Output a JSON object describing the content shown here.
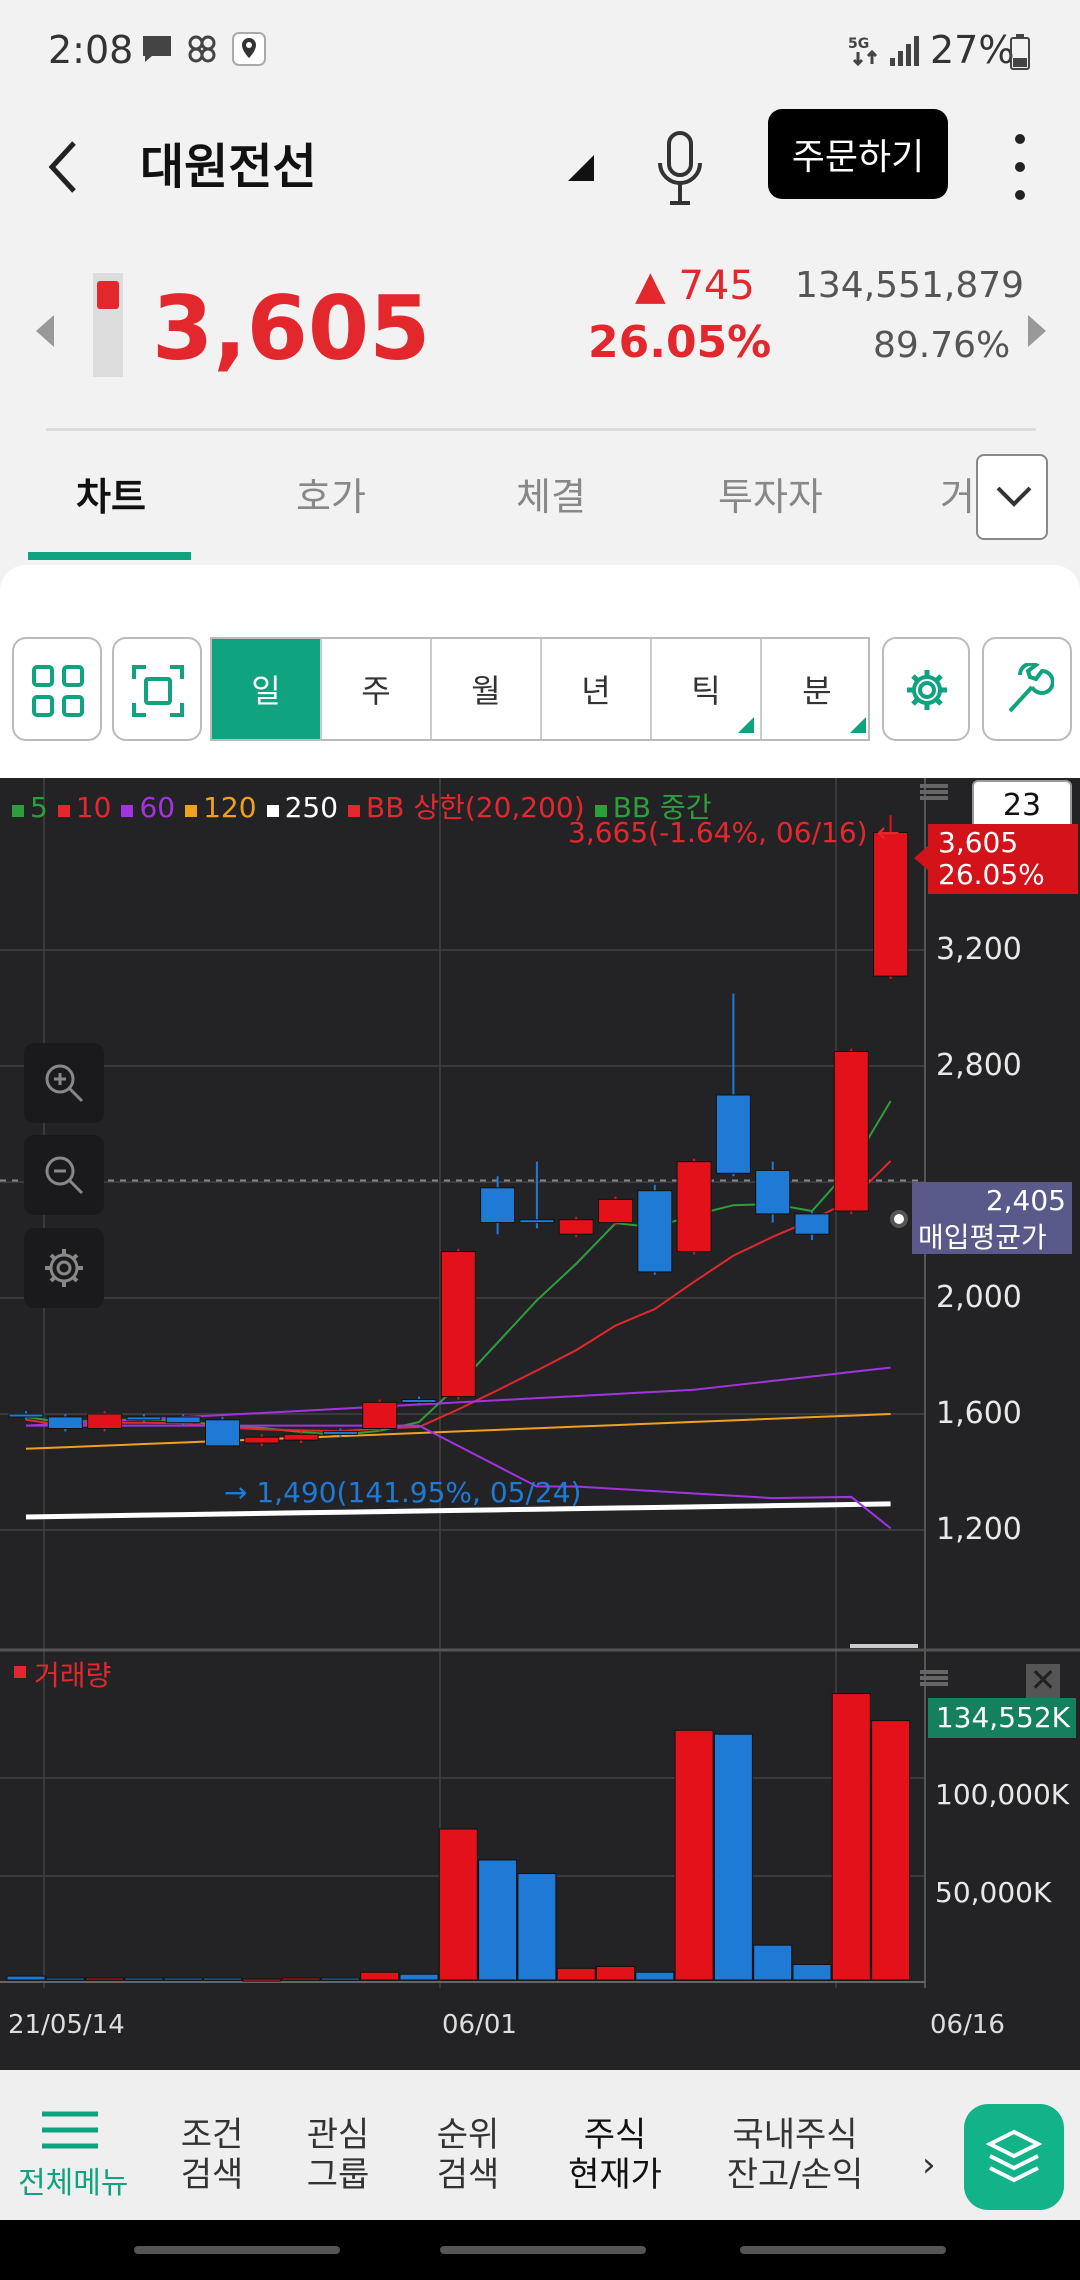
{
  "status_bar": {
    "time": "2:08",
    "right": "27%"
  },
  "header": {
    "title": "대원전선",
    "order_button": "주문하기"
  },
  "quote": {
    "price": "3,605",
    "change": "▲ 745",
    "change_pct": "26.05%",
    "volume": "134,551,879",
    "volume_pct": "89.76%"
  },
  "tabs": [
    "차트",
    "호가",
    "체결",
    "투자자",
    "거"
  ],
  "toolbar": {
    "periods": [
      "일",
      "주",
      "월",
      "년",
      "틱",
      "분"
    ]
  },
  "chart": {
    "legend": [
      {
        "label": "5",
        "color": "#2e9e3a"
      },
      {
        "label": "10",
        "color": "#e3282d"
      },
      {
        "label": "60",
        "color": "#a234e0"
      },
      {
        "label": "120",
        "color": "#f0a020"
      },
      {
        "label": "250",
        "color": "#ffffff"
      },
      {
        "label": "BB 상한(20,200)",
        "color": "#e3282d"
      },
      {
        "label": "BB 중간",
        "color": "#2e9e3a"
      }
    ],
    "count_box": "23",
    "high_note": "3,665(-1.64%, 06/16) ←",
    "low_note": "→ 1,490(141.95%, 05/24)",
    "price_tag": "3,605",
    "price_tag_pct": "26.05%",
    "avg_value": "2,405",
    "avg_label": "매입평균가",
    "y_ticks": [
      "3,200",
      "2,800",
      "2,000",
      "1,600",
      "1,200"
    ],
    "volume_label": "거래량",
    "volume_tag": "134,552K",
    "volume_ticks": [
      "100,000K",
      "50,000K"
    ],
    "x_labels": [
      "21/05/14",
      "06/01",
      "06/16"
    ]
  },
  "chart_data": {
    "type": "candlestick",
    "ylim": [
      1000,
      3800
    ],
    "candles": [
      {
        "o": 1600,
        "c": 1590,
        "h": 1610,
        "l": 1580,
        "up": false
      },
      {
        "o": 1590,
        "c": 1550,
        "h": 1600,
        "l": 1540,
        "up": false
      },
      {
        "o": 1550,
        "c": 1600,
        "h": 1610,
        "l": 1540,
        "up": true
      },
      {
        "o": 1590,
        "c": 1580,
        "h": 1600,
        "l": 1570,
        "up": false
      },
      {
        "o": 1590,
        "c": 1570,
        "h": 1600,
        "l": 1560,
        "up": false
      },
      {
        "o": 1580,
        "c": 1490,
        "h": 1590,
        "l": 1490,
        "up": false
      },
      {
        "o": 1500,
        "c": 1520,
        "h": 1530,
        "l": 1490,
        "up": true
      },
      {
        "o": 1510,
        "c": 1530,
        "h": 1540,
        "l": 1500,
        "up": true
      },
      {
        "o": 1540,
        "c": 1530,
        "h": 1550,
        "l": 1520,
        "up": false
      },
      {
        "o": 1550,
        "c": 1640,
        "h": 1650,
        "l": 1540,
        "up": true
      },
      {
        "o": 1650,
        "c": 1640,
        "h": 1660,
        "l": 1630,
        "up": false
      },
      {
        "o": 1660,
        "c": 2160,
        "h": 2170,
        "l": 1650,
        "up": true
      },
      {
        "o": 2380,
        "c": 2260,
        "h": 2420,
        "l": 2220,
        "up": false
      },
      {
        "o": 2270,
        "c": 2260,
        "h": 2470,
        "l": 2240,
        "up": false
      },
      {
        "o": 2220,
        "c": 2270,
        "h": 2280,
        "l": 2210,
        "up": true
      },
      {
        "o": 2260,
        "c": 2340,
        "h": 2350,
        "l": 2250,
        "up": true
      },
      {
        "o": 2370,
        "c": 2090,
        "h": 2390,
        "l": 2080,
        "up": false
      },
      {
        "o": 2160,
        "c": 2470,
        "h": 2480,
        "l": 2150,
        "up": true
      },
      {
        "o": 2700,
        "c": 2430,
        "h": 3050,
        "l": 2420,
        "up": false
      },
      {
        "o": 2440,
        "c": 2290,
        "h": 2470,
        "l": 2260,
        "up": false
      },
      {
        "o": 2290,
        "c": 2220,
        "h": 2300,
        "l": 2200,
        "up": false
      },
      {
        "o": 2300,
        "c": 2850,
        "h": 2860,
        "l": 2290,
        "up": true
      },
      {
        "o": 3110,
        "c": 3605,
        "h": 3665,
        "l": 3100,
        "up": true
      }
    ],
    "volume": [
      2,
      1,
      1,
      1,
      1,
      1,
      0.5,
      1,
      1,
      4,
      3,
      78,
      62,
      55,
      6,
      7,
      4,
      129,
      127,
      18,
      8,
      148,
      134
    ]
  }
}
